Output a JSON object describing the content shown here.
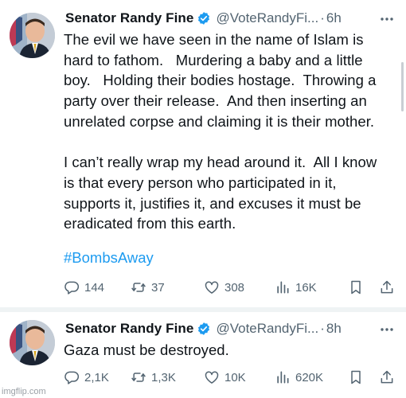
{
  "tweets": [
    {
      "author": "Senator Randy Fine",
      "handle": "@VoteRandyFi...",
      "separator": "·",
      "time": "6h",
      "text": "The evil we have seen in the name of Islam is\nhard to fathom.   Murdering a baby and a little\nboy.   Holding their bodies hostage.  Throwing a\nparty over their release.  And then inserting an\nunrelated corpse and claiming it is their mother.\n\nI can’t really wrap my head around it.  All I know\nis that every person who participated in it,\nsupports it, justifies it, and excuses it must be\neradicated from this earth.",
      "hashtag": "#BombsAway",
      "stats": {
        "replies": "144",
        "reposts": "37",
        "likes": "308",
        "views": "16K"
      }
    },
    {
      "author": "Senator Randy Fine",
      "handle": "@VoteRandyFi...",
      "separator": "·",
      "time": "8h",
      "text": "Gaza must be destroyed.",
      "stats": {
        "replies": "2,1K",
        "reposts": "1,3K",
        "likes": "10K",
        "views": "620K"
      }
    }
  ],
  "icons": {
    "verified": "verified-badge-icon",
    "more": "more-horizontal-icon",
    "reply": "reply-icon",
    "repost": "repost-icon",
    "like": "like-icon",
    "views": "views-icon",
    "bookmark": "bookmark-icon",
    "share": "share-icon"
  },
  "colors": {
    "accent": "#1d9bf0",
    "text": "#0f1419",
    "secondary": "#536471"
  },
  "watermark": "imgflip.com"
}
